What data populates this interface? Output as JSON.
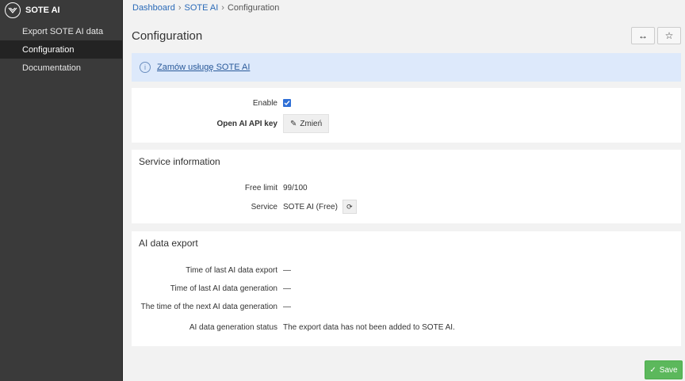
{
  "sidebar": {
    "brand": "SOTE AI",
    "items": [
      {
        "label": "Export SOTE AI data"
      },
      {
        "label": "Configuration"
      },
      {
        "label": "Documentation"
      }
    ]
  },
  "breadcrumb": {
    "items": [
      "Dashboard",
      "SOTE AI",
      "Configuration"
    ]
  },
  "page": {
    "title": "Configuration"
  },
  "info": {
    "link": "Zamów usługę SOTE AI"
  },
  "settings": {
    "enable_label": "Enable",
    "enable_checked": true,
    "api_key_label": "Open AI API key",
    "change_button": "Zmień"
  },
  "service": {
    "title": "Service information",
    "free_limit_label": "Free limit",
    "free_limit_value": "99/100",
    "service_label": "Service",
    "service_value": "SOTE AI (Free)"
  },
  "export": {
    "title": "AI data export",
    "rows": [
      {
        "label": "Time of last AI data export",
        "value": "—"
      },
      {
        "label": "Time of last AI data generation",
        "value": "—"
      },
      {
        "label": "The time of the next AI data generation",
        "value": "—"
      },
      {
        "label": "AI data generation status",
        "value": "The export data has not been added to SOTE AI."
      }
    ]
  },
  "footer": {
    "save": "Save"
  },
  "colors": {
    "sidebar_bg": "#3a3a3a",
    "accent": "#2f6fd6",
    "info_bg": "#dde9fb",
    "save_green": "#5cb85c"
  }
}
